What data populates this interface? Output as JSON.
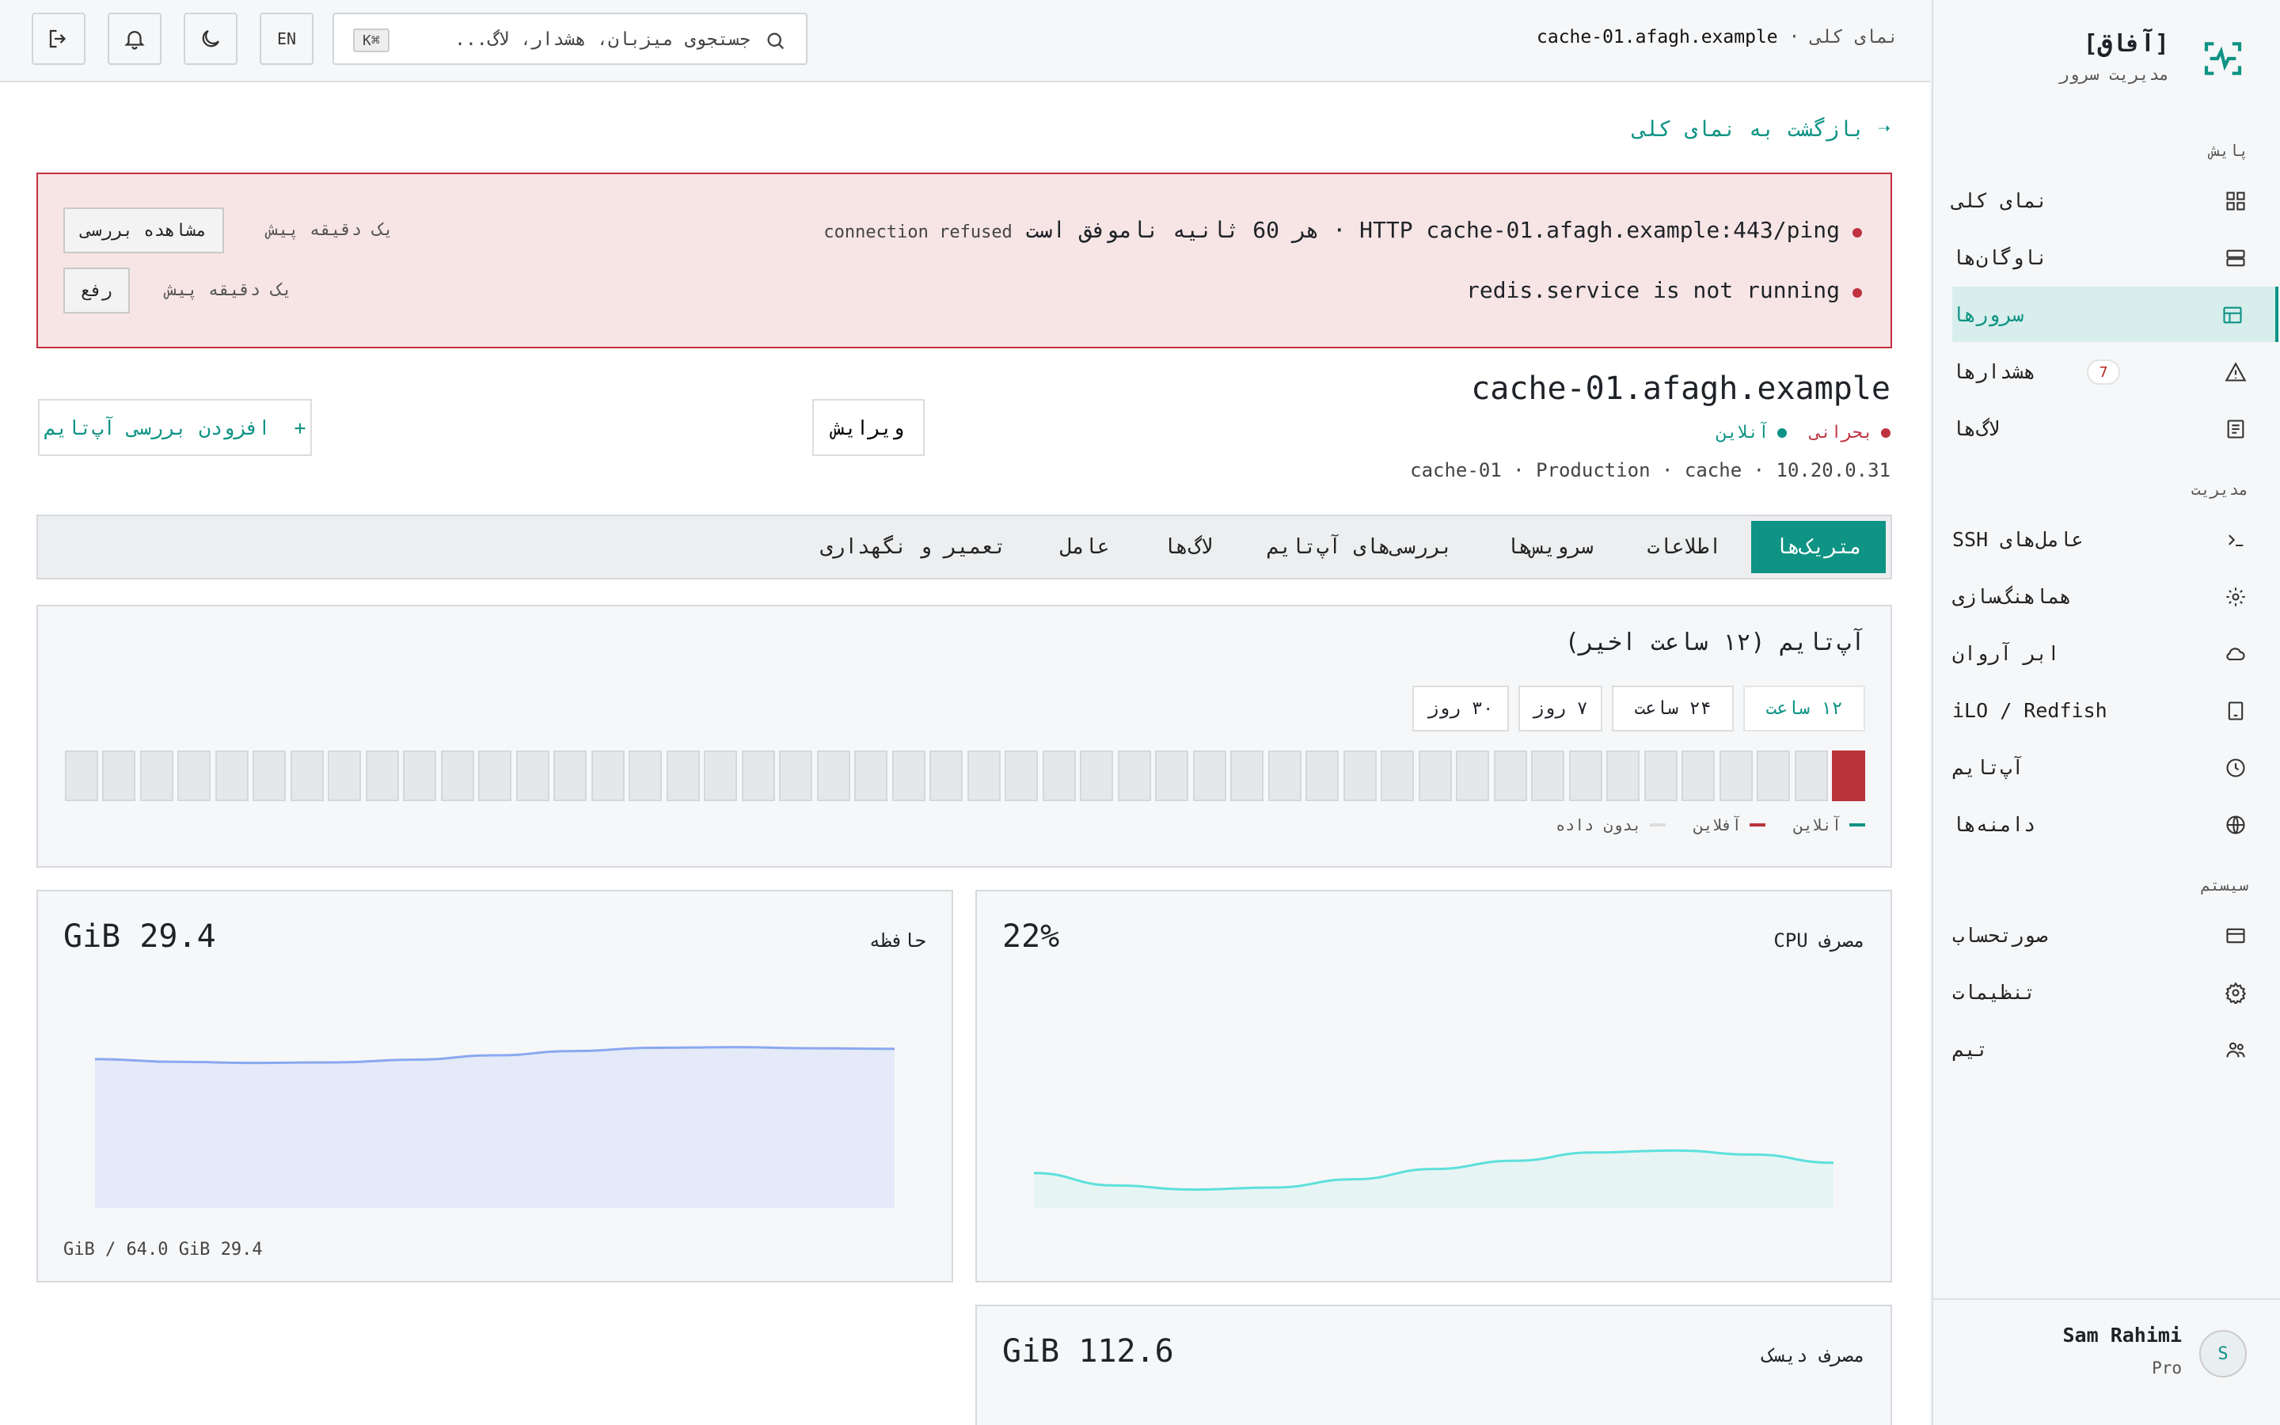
{
  "sidebar": {
    "brand": {
      "title": "[آفاق]",
      "subtitle": "مدیریت سرور"
    },
    "sections": {
      "monitor": "پایش",
      "manage": "مدیریت",
      "system": "سیستم"
    },
    "items": [
      {
        "label": "نمای کلی",
        "icon": "grid-icon"
      },
      {
        "label": "ناوگان‌ها",
        "icon": "server-stack-icon"
      },
      {
        "label": "سرورها",
        "icon": "server-icon",
        "active": true
      },
      {
        "label": "هشدارها",
        "icon": "warning-icon",
        "count": "7"
      },
      {
        "label": "لاگ‌ها",
        "icon": "log-icon"
      },
      {
        "label": "عامل‌های SSH",
        "icon": "terminal-icon"
      },
      {
        "label": "هماهنگ‌سازی",
        "icon": "sync-icon"
      },
      {
        "label": "ابر آروان",
        "icon": "cloud-icon"
      },
      {
        "label": "iLO / Redfish",
        "icon": "device-icon"
      },
      {
        "label": "آپ‌تایم",
        "icon": "clock-icon"
      },
      {
        "label": "دامنه‌ها",
        "icon": "globe-icon"
      },
      {
        "label": "صورتحساب",
        "icon": "card-icon"
      },
      {
        "label": "تنظیمات",
        "icon": "gear-icon"
      },
      {
        "label": "تیم",
        "icon": "team-icon"
      }
    ],
    "user": {
      "initial": "S",
      "name": "Sam Rahimi",
      "plan": "Pro"
    }
  },
  "topbar": {
    "breadcrumb_root": "نمای کلی",
    "breadcrumb_sep": "·",
    "breadcrumb_current": "cache-01.afagh.example",
    "search_placeholder": "جستجوی میزبان، هشدار، لاگ...",
    "search_shortcut": "⌘K",
    "lang": "EN"
  },
  "main": {
    "back_link": "بازگشت به نمای کلی",
    "alerts": [
      {
        "message": "HTTP cache-01.afagh.example:443/ping · هر 60 ثانیه ناموفق است",
        "detail": "connection refused",
        "time": "یک دقیقه پیش",
        "action": "مشاهده بررسی"
      },
      {
        "message": "redis.service is not running",
        "detail": "",
        "time": "یک دقیقه پیش",
        "action": "رفع"
      }
    ],
    "hostname": "cache-01.afagh.example",
    "status_critical": "بحرانی",
    "status_online": "آنلاین",
    "meta": "cache-01 · Production · cache · 10.20.0.31",
    "edit_button": "ویرایش",
    "add_uptime_button": "افزودن بررسی آپ‌تایم",
    "tabs": [
      "متریک‌ها",
      "اطلاعات",
      "سرویس‌ها",
      "بررسی‌های آپ‌تایم",
      "لاگ‌ها",
      "عامل",
      "تعمیر و نگهداری"
    ],
    "uptime": {
      "title": "آپ‌تایم (۱۲ ساعت اخیر)",
      "ranges": [
        "۱۲ ساعت",
        "۲۴ ساعت",
        "۷ روز",
        "۳۰ روز"
      ],
      "legend": [
        "آنلاین",
        "آفلاین",
        "بدون داده"
      ],
      "slots_offline": 1,
      "slots_total": 48
    },
    "cpu": {
      "title": "مصرف CPU",
      "value": "22%",
      "series": [
        0.17,
        0.11,
        0.09,
        0.1,
        0.14,
        0.19,
        0.23,
        0.27,
        0.28,
        0.26,
        0.22
      ]
    },
    "memory": {
      "title": "حافظه",
      "value": "29.4 GiB",
      "footer": "29.4 GiB / 64.0 GiB",
      "series": [
        27.5,
        27.0,
        26.8,
        26.9,
        27.4,
        28.2,
        29.0,
        29.6,
        29.7,
        29.5,
        29.4
      ]
    },
    "disk": {
      "title": "مصرف دیسک",
      "value": "112.6 GiB"
    }
  },
  "colors": {
    "accent": "#0e9384",
    "critical": "#c03240",
    "online": "#0e9384",
    "offline": "#b93339"
  }
}
